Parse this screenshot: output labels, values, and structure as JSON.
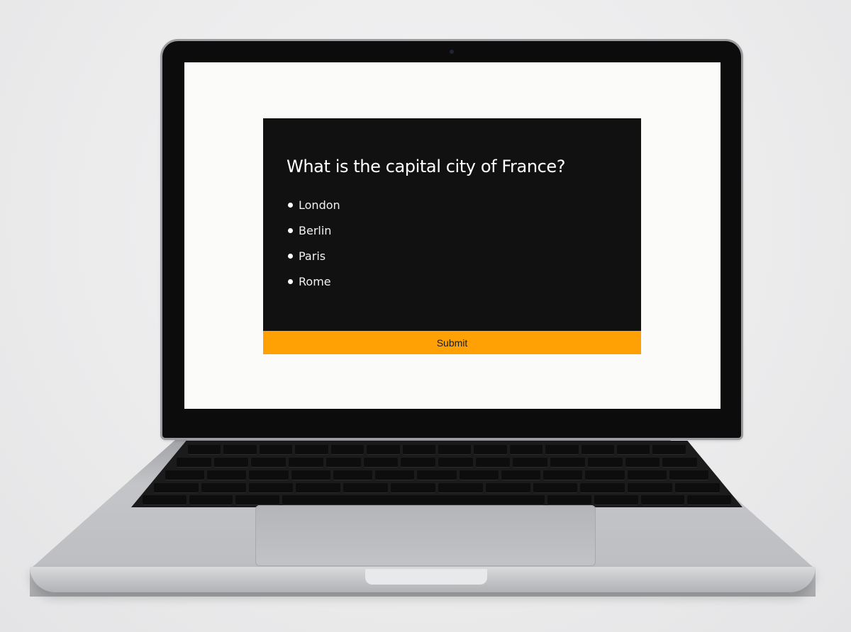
{
  "quiz": {
    "question": "What is the capital city of France?",
    "options": [
      "London",
      "Berlin",
      "Paris",
      "Rome"
    ],
    "submit_label": "Submit"
  },
  "colors": {
    "card_background": "#111111",
    "submit_button": "#ffa005",
    "screen_background": "#fbfbf9"
  }
}
